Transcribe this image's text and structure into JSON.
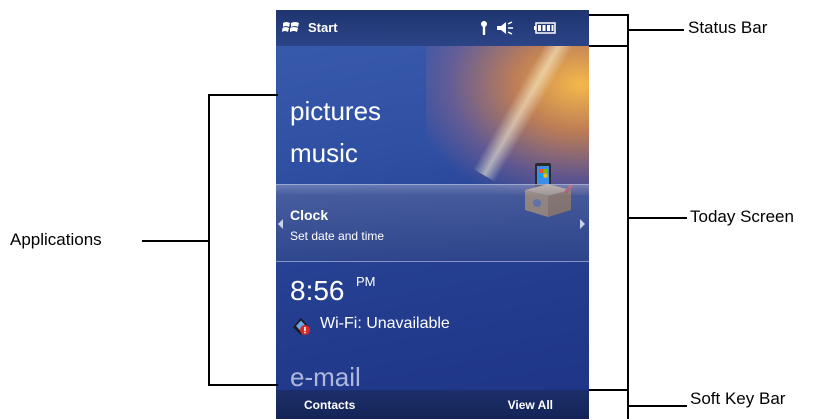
{
  "callouts": {
    "status_bar": "Status Bar",
    "today_screen": "Today Screen",
    "soft_key_bar": "Soft Key Bar",
    "applications": "Applications"
  },
  "status_bar": {
    "start_label": "Start",
    "icons": [
      "windows-flag-icon",
      "antenna-icon",
      "speaker-icon",
      "battery-icon"
    ]
  },
  "applications": {
    "items": [
      "pictures",
      "music"
    ]
  },
  "today": {
    "clock_title": "Clock",
    "clock_subtitle": "Set date and time",
    "time": "8:56",
    "ampm": "PM",
    "wifi_status": "Wi-Fi: Unavailable",
    "email": "e-mail"
  },
  "soft_keys": {
    "left": "Contacts",
    "right": "View All"
  },
  "colors": {
    "background_blue": "#2f4fa3",
    "glow_orange": "#f0a040",
    "bar_dark": "#1c2f6a"
  }
}
